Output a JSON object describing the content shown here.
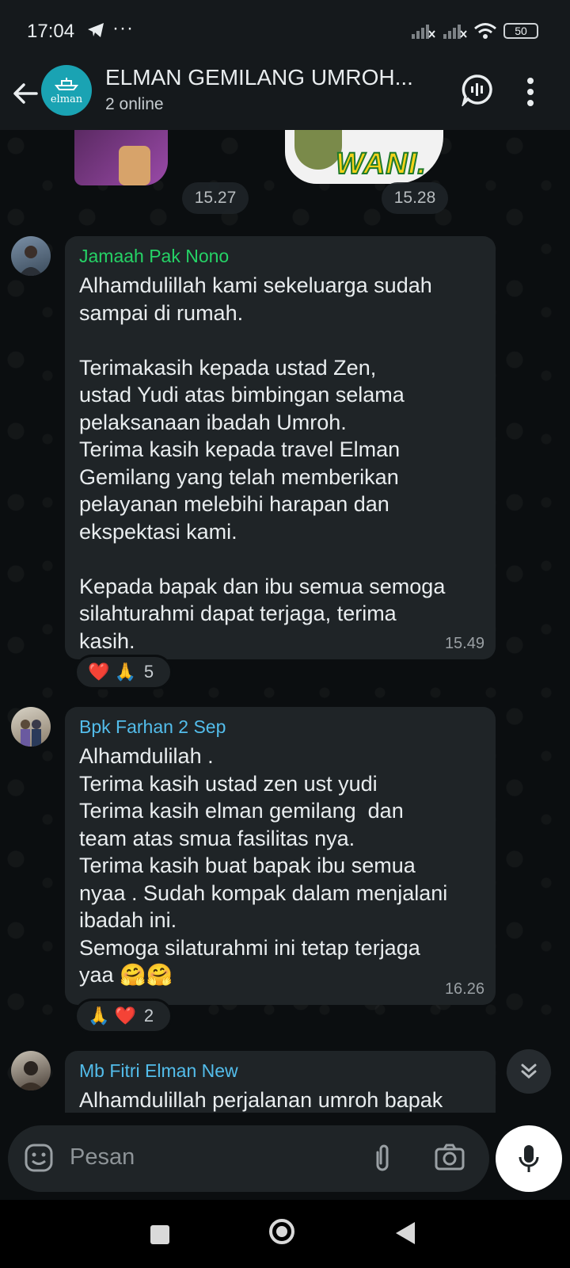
{
  "status_bar": {
    "time": "17:04",
    "more": "···",
    "battery": "50"
  },
  "header": {
    "title": "ELMAN GEMILANG UMROH...",
    "subtitle": "2 online",
    "logo_text": "elman"
  },
  "stickers": {
    "wani_text": "WANI."
  },
  "time_pills": [
    "15.27",
    "15.28"
  ],
  "messages": [
    {
      "sender": "Jamaah Pak Nono",
      "sender_color": "#25d366",
      "text": "Alhamdulillah kami sekeluarga sudah\nsampai di rumah.\n\nTerimakasih kepada ustad Zen,\nustad Yudi atas bimbingan selama\npelaksanaan ibadah Umroh.\nTerima kasih kepada travel Elman\nGemilang yang telah memberikan\npelayanan melebihi harapan dan\nekspektasi kami.\n\nKepada bapak dan ibu semua semoga\nsilahturahmi dapat terjaga, terima\nkasih.",
      "time": "15.49",
      "reactions": {
        "emojis": "❤️ 🙏",
        "count": "5"
      }
    },
    {
      "sender": "Bpk Farhan 2 Sep",
      "sender_color": "#53bdeb",
      "text": "Alhamdulilah .\nTerima kasih ustad zen ust yudi\nTerima kasih elman gemilang  dan\nteam atas smua fasilitas nya.\nTerima kasih buat bapak ibu semua\nnyaa . Sudah kompak dalam menjalani\nibadah ini.\nSemoga silaturahmi ini tetap terjaga\nyaa 🤗🤗",
      "time": "16.26",
      "reactions": {
        "emojis": "🙏 ❤️",
        "count": "2"
      }
    },
    {
      "sender": "Mb Fitri Elman New",
      "sender_color": "#53bdeb",
      "text": "Alhamdulillah perjalanan umroh bapak"
    }
  ],
  "input": {
    "placeholder": "Pesan"
  },
  "icons": [
    "back-arrow-icon",
    "voice-call-icon",
    "more-vert-icon",
    "emoji-icon",
    "attach-icon",
    "camera-icon",
    "mic-icon",
    "scroll-down-icon"
  ]
}
